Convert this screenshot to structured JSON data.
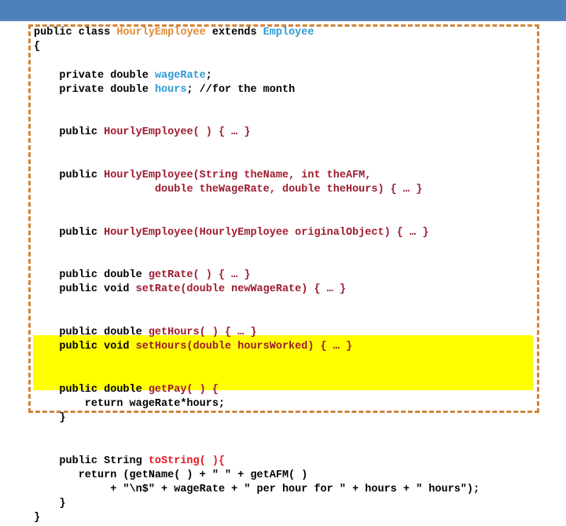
{
  "slide": {
    "background_color": "#ffffff",
    "top_bar_color": "#4d81bd",
    "frame_border_color": "#d2843c",
    "highlight_color": "#ffff00"
  },
  "palette": {
    "class_name": "#e08a36",
    "superclass": "#2e9bd4",
    "field": "#2e9bd4",
    "method": "#9e1b2f",
    "to_string": "#e8141e",
    "plain": "#000000"
  },
  "code": {
    "language": "java",
    "class_name": "HourlyEmployee",
    "superclass": "Employee",
    "lines": [
      {
        "id": "line-1",
        "text": "public class HourlyEmployee extends Employee"
      },
      {
        "id": "line-2",
        "text": "{"
      },
      {
        "id": "line-3",
        "text": ""
      },
      {
        "id": "line-4",
        "text": "    private double wageRate;"
      },
      {
        "id": "line-5",
        "text": "    private double hours; //for the month"
      },
      {
        "id": "line-6",
        "text": ""
      },
      {
        "id": "line-7",
        "text": ""
      },
      {
        "id": "line-8",
        "text": "    public HourlyEmployee( ) { … }"
      },
      {
        "id": "line-9",
        "text": ""
      },
      {
        "id": "line-10",
        "text": ""
      },
      {
        "id": "line-11",
        "text": "    public HourlyEmployee(String theName, int theAFM,"
      },
      {
        "id": "line-12",
        "text": "                   double theWageRate, double theHours) { … }"
      },
      {
        "id": "line-13",
        "text": ""
      },
      {
        "id": "line-14",
        "text": ""
      },
      {
        "id": "line-15",
        "text": "    public HourlyEmployee(HourlyEmployee originalObject) { … }"
      },
      {
        "id": "line-16",
        "text": ""
      },
      {
        "id": "line-17",
        "text": ""
      },
      {
        "id": "line-18",
        "text": "    public double getRate( ) { … }"
      },
      {
        "id": "line-19",
        "text": "    public void setRate(double newWageRate) { … }"
      },
      {
        "id": "line-20",
        "text": ""
      },
      {
        "id": "line-21",
        "text": ""
      },
      {
        "id": "line-22",
        "text": "    public double getHours( ) { … }"
      },
      {
        "id": "line-23",
        "text": "    public void setHours(double hoursWorked) { … }"
      },
      {
        "id": "line-24",
        "text": ""
      },
      {
        "id": "line-25",
        "text": ""
      },
      {
        "id": "line-26",
        "text": "    public double getPay( ) {"
      },
      {
        "id": "line-27",
        "text": "        return wageRate*hours;"
      },
      {
        "id": "line-28",
        "text": "    }"
      },
      {
        "id": "line-29",
        "text": ""
      },
      {
        "id": "line-30",
        "text": ""
      },
      {
        "id": "line-31",
        "text": "    public String toString( ){"
      },
      {
        "id": "line-32",
        "text": "       return (getName( ) + \" \" + getAFM( )"
      },
      {
        "id": "line-33",
        "text": "            + \"\\n$\" + wageRate + \" per hour for \" + hours + \" hours\");"
      },
      {
        "id": "line-34",
        "text": "    }"
      },
      {
        "id": "line-35",
        "text": "}"
      }
    ],
    "segments": [
      [
        {
          "t": "public class ",
          "c": "plain"
        },
        {
          "t": "HourlyEmployee",
          "c": "class_name"
        },
        {
          "t": " extends ",
          "c": "plain"
        },
        {
          "t": "Employee",
          "c": "superclass"
        }
      ],
      [
        {
          "t": "{",
          "c": "plain"
        }
      ],
      [],
      [
        {
          "t": "    private double ",
          "c": "plain"
        },
        {
          "t": "wageRate",
          "c": "field"
        },
        {
          "t": ";",
          "c": "plain"
        }
      ],
      [
        {
          "t": "    private double ",
          "c": "plain"
        },
        {
          "t": "hours",
          "c": "field"
        },
        {
          "t": "; //for the month",
          "c": "plain"
        }
      ],
      [],
      [],
      [
        {
          "t": "    public ",
          "c": "plain"
        },
        {
          "t": "HourlyEmployee( ) { … }",
          "c": "method"
        }
      ],
      [],
      [],
      [
        {
          "t": "    public ",
          "c": "plain"
        },
        {
          "t": "HourlyEmployee(String theName, int theAFM,",
          "c": "method"
        }
      ],
      [
        {
          "t": "                   ",
          "c": "plain"
        },
        {
          "t": "double theWageRate, double theHours) { … }",
          "c": "method"
        }
      ],
      [],
      [],
      [
        {
          "t": "    public ",
          "c": "plain"
        },
        {
          "t": "HourlyEmployee(HourlyEmployee originalObject) { … }",
          "c": "method"
        }
      ],
      [],
      [],
      [
        {
          "t": "    public double ",
          "c": "plain"
        },
        {
          "t": "getRate( ) { … }",
          "c": "method"
        }
      ],
      [
        {
          "t": "    public void ",
          "c": "plain"
        },
        {
          "t": "setRate(double newWageRate) { … }",
          "c": "method"
        }
      ],
      [],
      [],
      [
        {
          "t": "    public double ",
          "c": "plain"
        },
        {
          "t": "getHours( ) { … }",
          "c": "method"
        }
      ],
      [
        {
          "t": "    public void ",
          "c": "plain"
        },
        {
          "t": "setHours(double hoursWorked) { … }",
          "c": "method"
        }
      ],
      [],
      [],
      [
        {
          "t": "    public double ",
          "c": "plain"
        },
        {
          "t": "getPay( ) {",
          "c": "method"
        }
      ],
      [
        {
          "t": "        return wageRate*hours;",
          "c": "plain"
        }
      ],
      [
        {
          "t": "    }",
          "c": "plain"
        }
      ],
      [],
      [],
      [
        {
          "t": "    public String ",
          "c": "plain"
        },
        {
          "t": "toString( ){",
          "c": "to_string"
        }
      ],
      [
        {
          "t": "       return (getName( ) + \" \" + getAFM( )",
          "c": "plain"
        }
      ],
      [
        {
          "t": "            + \"\\n$\" + wageRate + \" per hour for \" + hours + \" hours\");",
          "c": "plain"
        }
      ],
      [
        {
          "t": "    }",
          "c": "plain"
        }
      ],
      [
        {
          "t": "}",
          "c": "plain"
        }
      ]
    ],
    "highlighted_line_ids": [
      "line-31",
      "line-32",
      "line-33",
      "line-34"
    ]
  }
}
